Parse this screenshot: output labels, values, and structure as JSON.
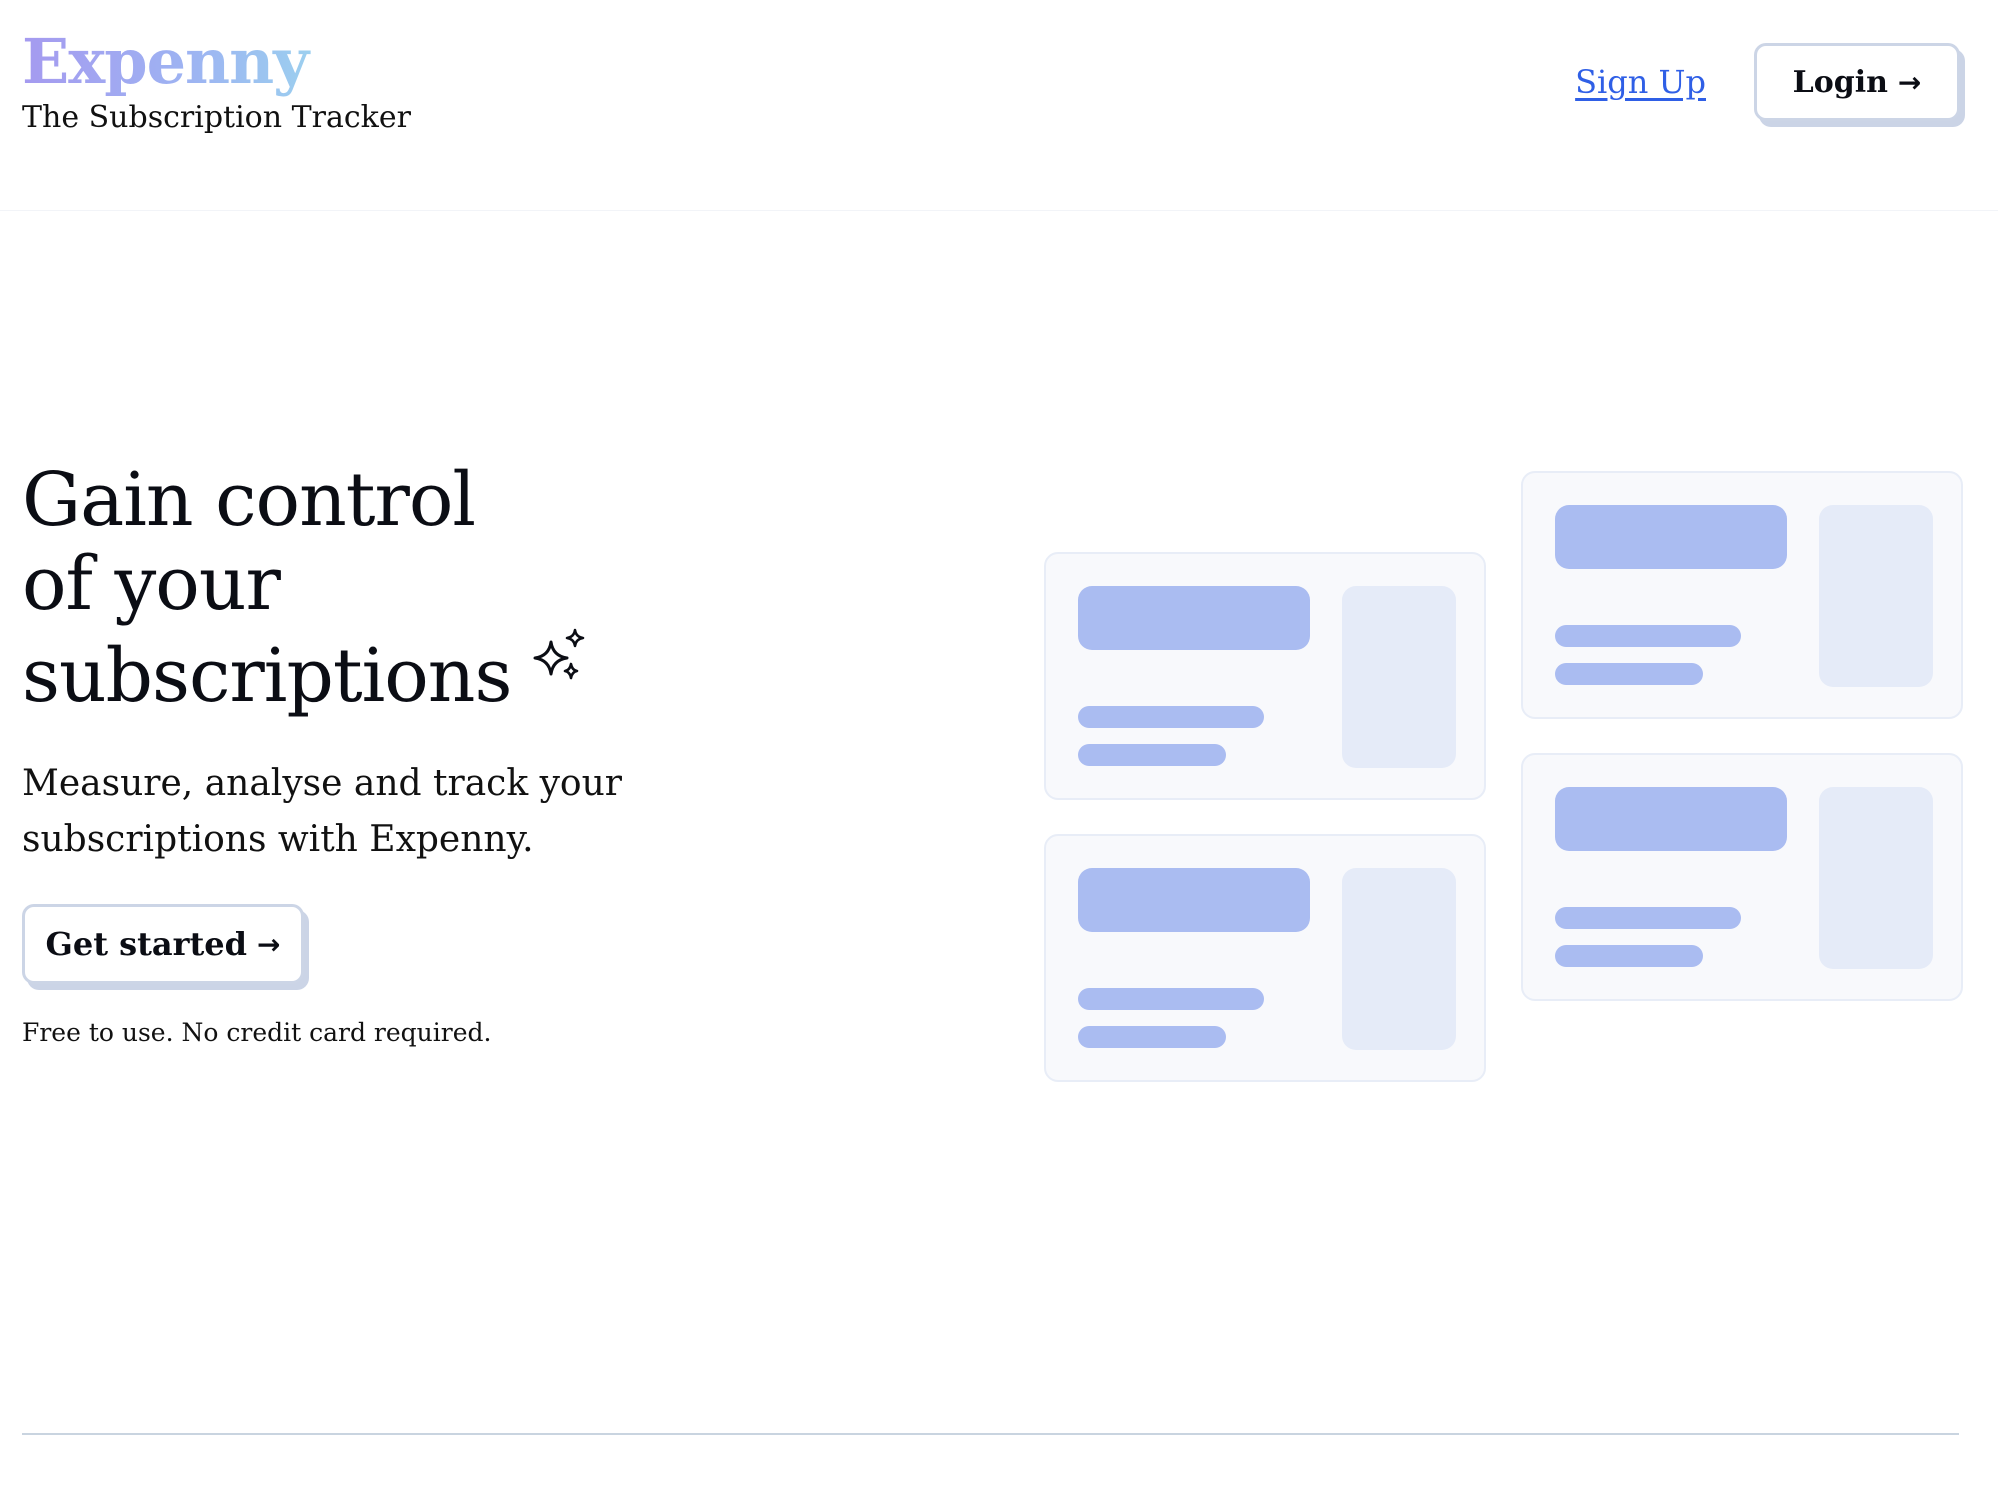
{
  "header": {
    "brand_name": "Expenny",
    "tagline": "The Subscription Tracker",
    "signup_label": "Sign Up",
    "login_label": "Login",
    "login_icon": "arrow-right-icon"
  },
  "hero": {
    "title_line1": "Gain control",
    "title_line2": "of your",
    "title_line3": "subscriptions",
    "title_icon": "sparkles-icon",
    "subtitle": "Measure, analyse and track your subscriptions with Expenny.",
    "cta_label": "Get started",
    "cta_icon": "arrow-right-icon",
    "note": "Free to use. No credit card required."
  },
  "colors": {
    "brand_gradient_start": "#a59af0",
    "brand_gradient_end": "#9ae6ec",
    "link": "#2f5fe6",
    "placeholder_accent": "#aabcf1",
    "placeholder_muted": "#e5ebf8",
    "card_background": "#f8f9fc"
  }
}
